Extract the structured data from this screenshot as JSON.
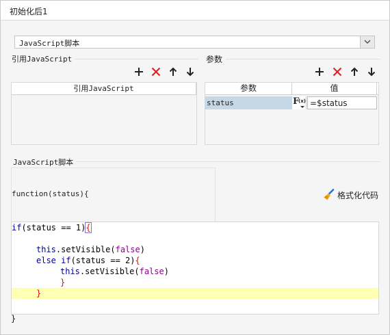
{
  "window": {
    "title": "初始化后1"
  },
  "script_type_select": {
    "value": "JavaScript脚本"
  },
  "ref_section": {
    "label": "引用JavaScript",
    "column_header": "引用JavaScript"
  },
  "params_section": {
    "label": "参数",
    "columns": [
      "参数",
      "值"
    ],
    "rows": [
      {
        "name": "status",
        "fx": "F",
        "fx_sub": "(x)",
        "value": "=$status"
      }
    ]
  },
  "script_section": {
    "label": "JavaScript脚本",
    "function_header": "function(status){",
    "format_button": "格式化代码",
    "closing_brace": "}"
  },
  "code": {
    "l1_kw": "if",
    "l1_rest": "(status == 1)",
    "l1_brace": "{",
    "l3_kw": "this",
    "l3_call": ".setVisible(",
    "l3_arg": "false",
    "l3_end": ")",
    "l4_kw": "else if",
    "l4_rest": "(status == 2)",
    "l4_brace": "{",
    "l5_kw": "this",
    "l5_call": ".setVisible(",
    "l5_arg": "false",
    "l5_end": ")",
    "l6": "}",
    "l7": "}"
  },
  "toolbar_icons": [
    "add-icon",
    "delete-icon",
    "move-up-icon",
    "move-down-icon"
  ],
  "colors": {
    "keyword": "#00008b",
    "literal": "#8b008b",
    "brace": "#d21414",
    "highlight": "#ffffb3",
    "selected_row": "#c6d8e6"
  }
}
